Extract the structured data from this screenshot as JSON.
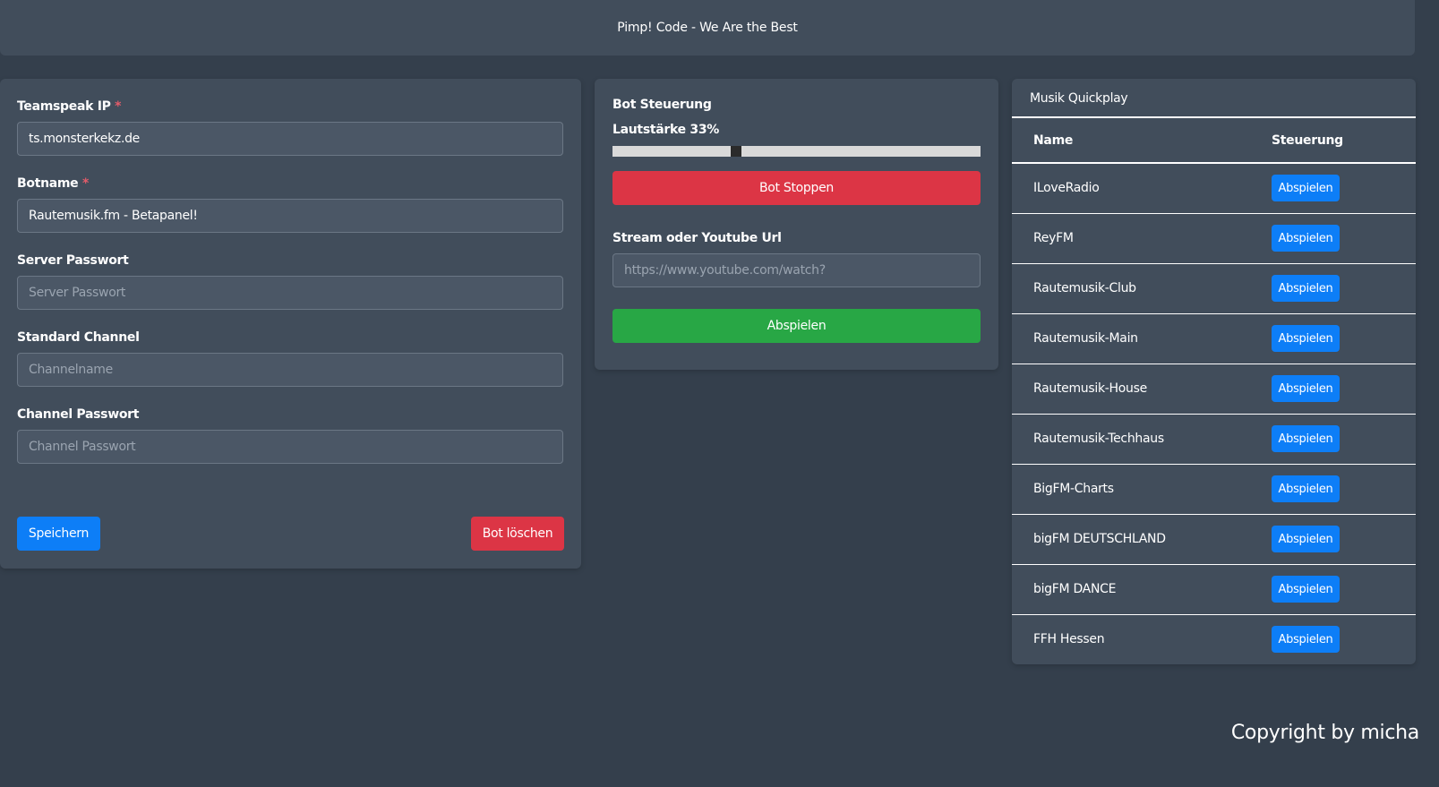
{
  "header": {
    "title": "Pimp! Code - We Are the Best"
  },
  "settings": {
    "teamspeak_ip": {
      "label": "Teamspeak IP",
      "required": "*",
      "value": "ts.monsterkekz.de",
      "placeholder": ""
    },
    "botname": {
      "label": "Botname",
      "required": "*",
      "value": "Rautemusik.fm - Betapanel!",
      "placeholder": ""
    },
    "server_password": {
      "label": "Server Passwort",
      "value": "",
      "placeholder": "Server Passwort"
    },
    "standard_channel": {
      "label": "Standard Channel",
      "value": "",
      "placeholder": "Channelname"
    },
    "channel_password": {
      "label": "Channel Passwort",
      "value": "",
      "placeholder": "Channel Passwort"
    },
    "save_label": "Speichern",
    "delete_label": "Bot löschen"
  },
  "control": {
    "title": "Bot Steuerung",
    "volume_label": "Lautstärke 33%",
    "volume": 33,
    "stop_label": "Bot Stoppen",
    "url_label": "Stream oder Youtube Url",
    "url_value": "",
    "url_placeholder": "https://www.youtube.com/watch?",
    "play_label": "Abspielen"
  },
  "quickplay": {
    "title": "Musik Quickplay",
    "columns": [
      "Name",
      "Steuerung"
    ],
    "button_label": "Abspielen",
    "stations": [
      "ILoveRadio",
      "ReyFM",
      "Rautemusik-Club",
      "Rautemusik-Main",
      "Rautemusik-House",
      "Rautemusik-Techhaus",
      "BigFM-Charts",
      "bigFM DEUTSCHLAND",
      "bigFM DANCE",
      "FFH Hessen"
    ]
  },
  "footer": {
    "copyright": "Copyright by micha"
  },
  "colors": {
    "background": "#343f4c",
    "card": "#414d5b",
    "primary": "#0d7ef7",
    "danger": "#dc3545",
    "success": "#28a745"
  }
}
